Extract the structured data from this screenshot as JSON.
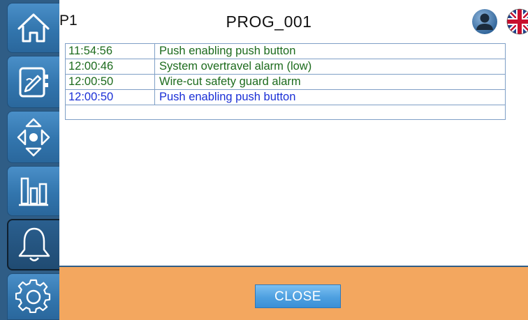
{
  "header": {
    "program_number": "P1",
    "program_name": "PROG_001"
  },
  "sidebar": {
    "items": [
      {
        "icon": "home-icon"
      },
      {
        "icon": "program-editor-icon"
      },
      {
        "icon": "manual-move-icon"
      },
      {
        "icon": "statistics-icon"
      },
      {
        "icon": "alarm-bell-icon",
        "active": true
      },
      {
        "icon": "settings-gear-icon"
      }
    ]
  },
  "alarms": [
    {
      "time": "11:54:56",
      "message": "Push enabling push button",
      "color": "#1d6b1d"
    },
    {
      "time": "12:00:46",
      "message": "System overtravel alarm (low)",
      "color": "#1d6b1d"
    },
    {
      "time": "12:00:50",
      "message": "Wire-cut safety guard alarm",
      "color": "#1d6b1d"
    },
    {
      "time": "12:00:50",
      "message": "Push enabling push button",
      "color": "#1a2fd6"
    }
  ],
  "footer": {
    "close_label": "CLOSE"
  },
  "colors": {
    "sidebar_bg": "#2f5d86",
    "footer_bg": "#f3a75f",
    "close_button": "#4ea0e0"
  }
}
